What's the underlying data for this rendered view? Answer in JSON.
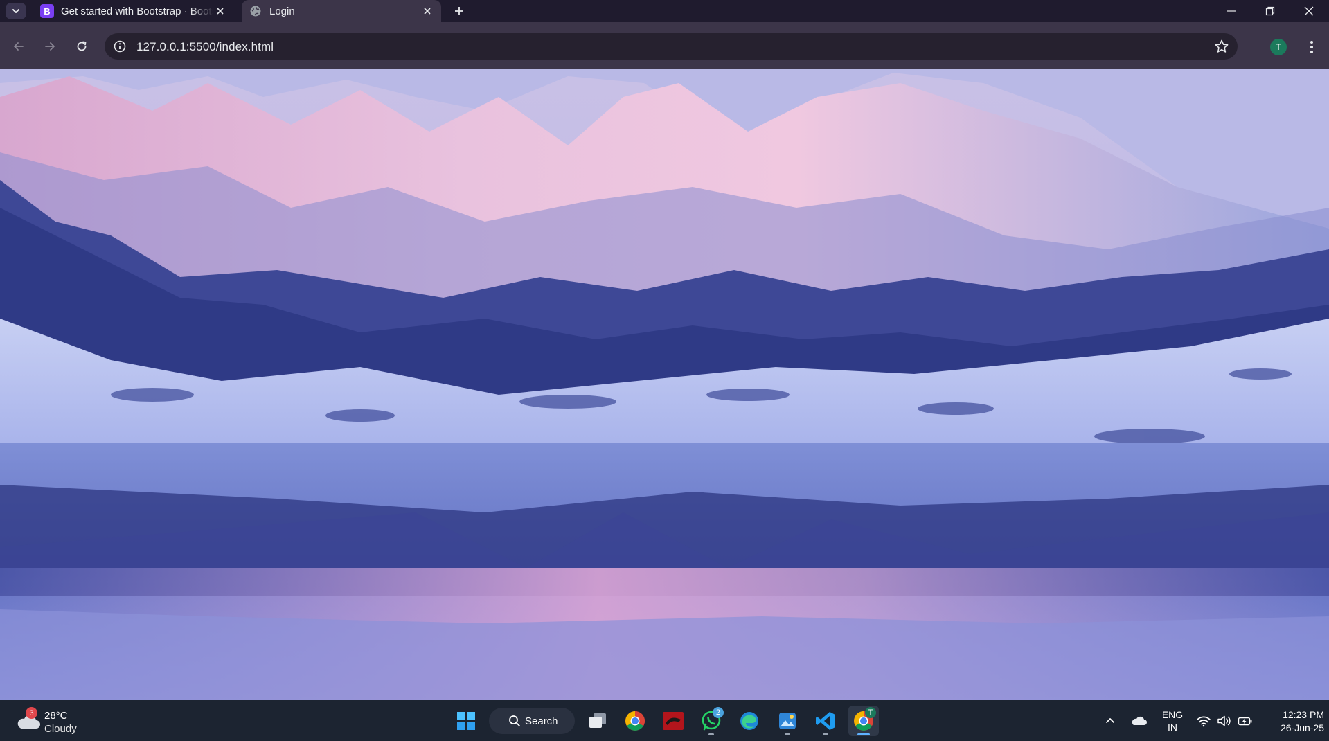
{
  "browser": {
    "tabs": [
      {
        "title": "Get started with Bootstrap · Bootstrap",
        "favicon": "bootstrap-icon",
        "favicon_letter": "B",
        "active": false
      },
      {
        "title": "Login",
        "favicon": "globe-icon",
        "active": true
      }
    ],
    "address_bar": {
      "url": "127.0.0.1:5500/index.html"
    },
    "profile_initial": "T"
  },
  "page": {
    "background": "snowy-mountain-lake-photo"
  },
  "taskbar": {
    "weather": {
      "temperature": "28°C",
      "condition": "Cloudy",
      "badge": "3"
    },
    "search_label": "Search",
    "apps": [
      {
        "name": "start-icon"
      },
      {
        "name": "task-view-icon"
      },
      {
        "name": "chrome-icon"
      },
      {
        "name": "red-app-icon"
      },
      {
        "name": "whatsapp-icon",
        "badge": "2"
      },
      {
        "name": "edge-icon"
      },
      {
        "name": "photos-icon"
      },
      {
        "name": "vscode-icon"
      },
      {
        "name": "chrome-profile-icon",
        "active": true,
        "badge": "T"
      }
    ],
    "tray": {
      "language_line1": "ENG",
      "language_line2": "IN",
      "time": "12:23 PM",
      "date": "26-Jun-25"
    }
  },
  "colors": {
    "tabstrip": "#1f1b2e",
    "toolbar": "#3c3549",
    "omnibox": "#26212f",
    "taskbar": "#1c2431",
    "accent": "#5fb2ff"
  }
}
